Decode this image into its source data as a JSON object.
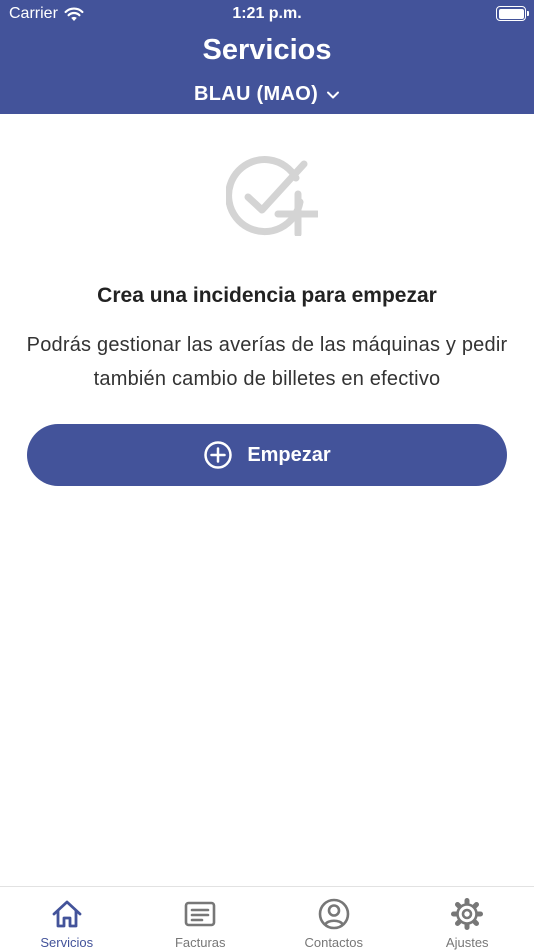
{
  "status_bar": {
    "carrier": "Carrier",
    "time": "1:21 p.m."
  },
  "header": {
    "title": "Servicios",
    "location": "BLAU (MAO)",
    "location_icon": "chevron-down-icon"
  },
  "empty_state": {
    "icon": "check-plus-icon",
    "title": "Crea una incidencia para empezar",
    "description": "Podrás gestionar las averías de las máquinas y pedir también cambio de billetes en efectivo"
  },
  "start_button": {
    "icon": "plus-circle-icon",
    "label": "Empezar"
  },
  "tab_bar": {
    "items": [
      {
        "label": "Servicios",
        "icon": "home-icon",
        "active": true
      },
      {
        "label": "Facturas",
        "icon": "invoice-icon",
        "active": false
      },
      {
        "label": "Contactos",
        "icon": "user-circle-icon",
        "active": false
      },
      {
        "label": "Ajustes",
        "icon": "gear-icon",
        "active": false
      }
    ]
  },
  "colors": {
    "primary": "#43539a",
    "inactive": "#777777",
    "empty_icon": "#d4d4d4"
  }
}
